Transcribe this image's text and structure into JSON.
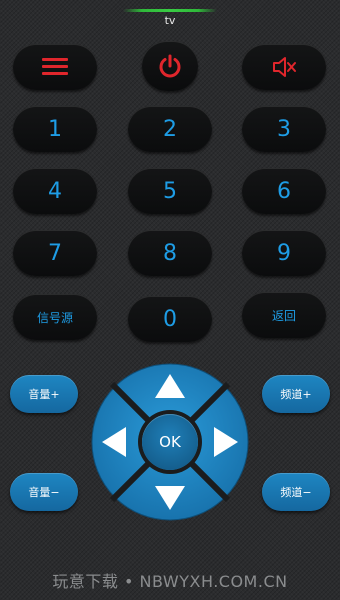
{
  "header": {
    "device_label": "tv"
  },
  "top_row": {
    "menu_icon": "menu-icon",
    "power_icon": "power-icon",
    "mute_icon": "mute-icon"
  },
  "keypad": {
    "k1": "1",
    "k2": "2",
    "k3": "3",
    "k4": "4",
    "k5": "5",
    "k6": "6",
    "k7": "7",
    "k8": "8",
    "k9": "9",
    "k0": "0",
    "source": "信号源",
    "back": "返回"
  },
  "controls": {
    "vol_up": "音量+",
    "vol_down": "音量−",
    "ch_up": "频道+",
    "ch_down": "频道−"
  },
  "dpad": {
    "ok": "OK",
    "up_icon": "up-arrow-icon",
    "down_icon": "down-arrow-icon",
    "left_icon": "left-arrow-icon",
    "right_icon": "right-arrow-icon"
  },
  "watermark": "玩意下载 • NBWYXH.COM.CN",
  "colors": {
    "accent": "#1e9de6",
    "alert": "#e0262c",
    "dpad_blue": "#1e8ac8",
    "indicator": "#39cc44"
  }
}
